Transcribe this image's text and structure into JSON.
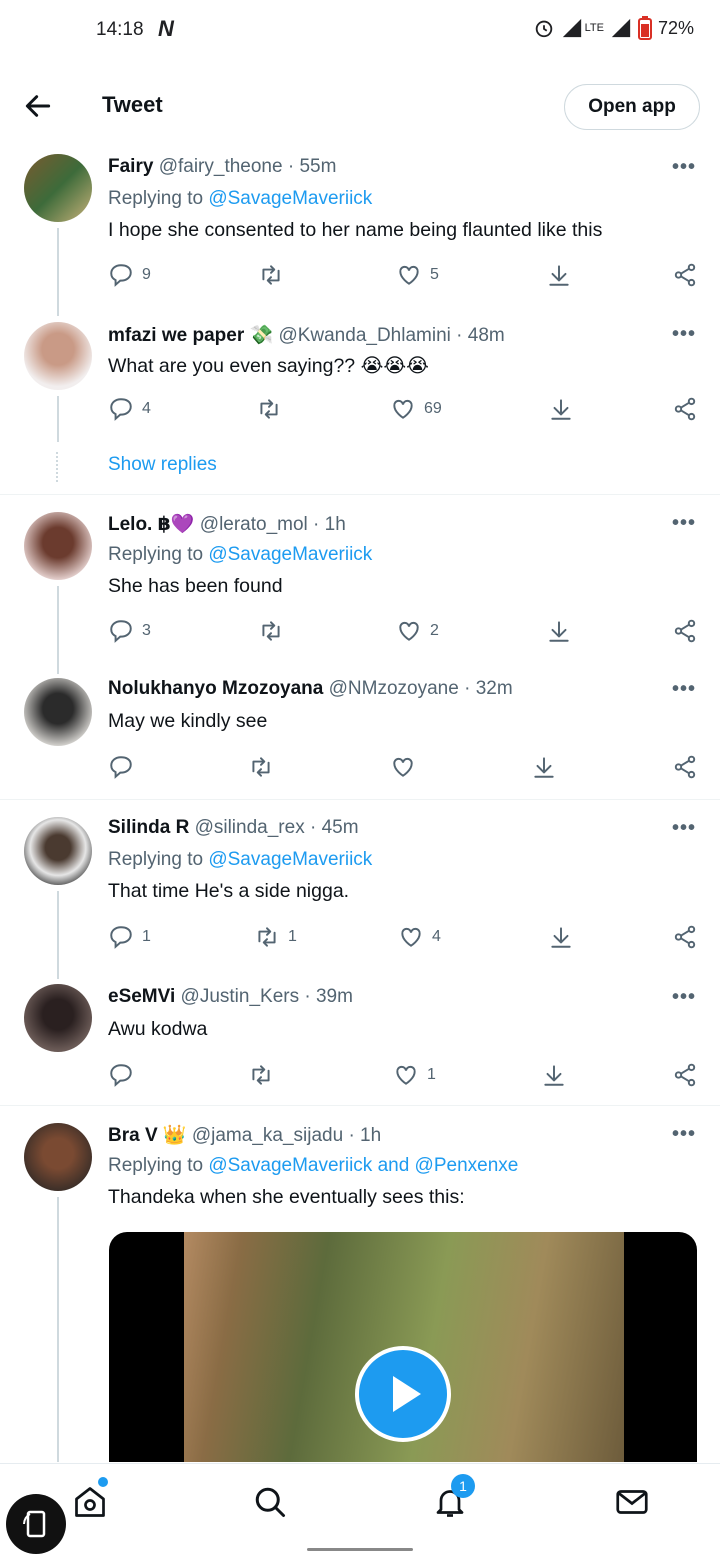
{
  "status_bar": {
    "time": "14:18",
    "logo_letter": "N",
    "network": "LTE",
    "battery": "72%"
  },
  "header": {
    "title": "Tweet",
    "open_app_label": "Open app"
  },
  "tweets": [
    {
      "name": "Fairy",
      "handle": "@fairy_theone · 55m",
      "replying_prefix": "Replying to ",
      "replying_to": "@SavageMaveriick",
      "text": "I hope she consented to her name being flaunted like this",
      "replies": "9",
      "retweets": "",
      "likes": "5"
    },
    {
      "name": "mfazi we paper 💸",
      "handle": "@Kwanda_Dhlamini · 48m",
      "text": "What are you even saying?? 😭😭😭",
      "replies": "4",
      "retweets": "",
      "likes": "69"
    },
    {
      "show_replies": "Show replies"
    },
    {
      "name": "Lelo. ฿💜",
      "handle": "@lerato_mol · 1h",
      "replying_prefix": "Replying to ",
      "replying_to": "@SavageMaveriick",
      "text": "She has been found",
      "replies": "3",
      "retweets": "",
      "likes": "2"
    },
    {
      "name": "Nolukhanyo Mzozoyana",
      "handle": "@NMzozoyane · 32m",
      "text": "May we kindly see",
      "replies": "",
      "retweets": "",
      "likes": ""
    },
    {
      "name": "Silinda R",
      "handle": "@silinda_rex · 45m",
      "replying_prefix": "Replying to ",
      "replying_to": "@SavageMaveriick",
      "text": "That time He's a side nigga.",
      "replies": "1",
      "retweets": "1",
      "likes": "4"
    },
    {
      "name": "eSeMVi",
      "handle": "@Justin_Kers · 39m",
      "text": "Awu kodwa",
      "replies": "",
      "retweets": "",
      "likes": "1"
    },
    {
      "name": "Bra V 👑",
      "handle": "@jama_ka_sijadu · 1h",
      "replying_prefix": "Replying to ",
      "replying_to": "@SavageMaveriick and @Penxenxe",
      "text": "Thandeka when she eventually sees this:"
    }
  ],
  "bottom_nav": {
    "notifications_count": "1"
  },
  "colors": {
    "accent": "#1d9bf0",
    "text": "#0f1419",
    "muted": "#536471"
  }
}
